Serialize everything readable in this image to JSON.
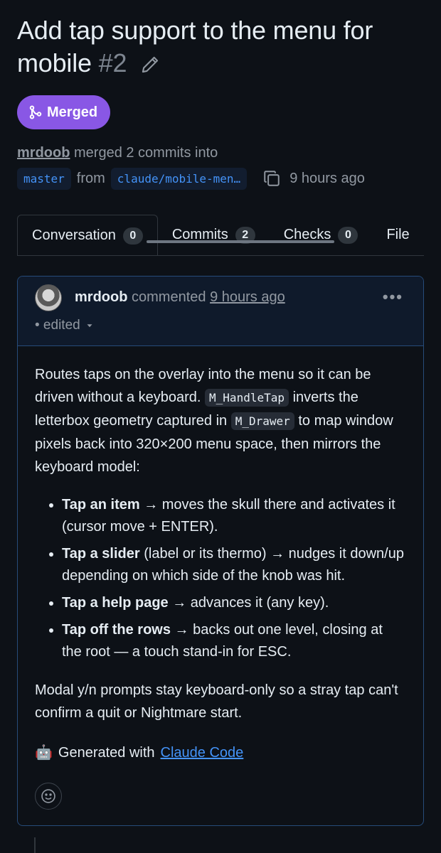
{
  "pr": {
    "title": "Add tap support to the menu for mobile",
    "number": "#2",
    "state": "Merged",
    "author": "mrdoob",
    "merge_text": "merged 2 commits into",
    "base_branch": "master",
    "from_text": "from",
    "head_branch": "claude/mobile-men…",
    "time": "9 hours ago"
  },
  "tabs": [
    {
      "label": "Conversation",
      "count": "0"
    },
    {
      "label": "Commits",
      "count": "2"
    },
    {
      "label": "Checks",
      "count": "0"
    },
    {
      "label": "File"
    }
  ],
  "comment": {
    "author": "mrdoob",
    "action": "commented",
    "time": "9 hours ago",
    "edited": "• edited",
    "intro_1": "Routes taps on the overlay into the menu so it can be driven without a keyboard.",
    "code_1": "M_HandleTap",
    "intro_2": "inverts the letterbox geometry captured in",
    "code_2": "M_Drawer",
    "intro_3": "to map window pixels back into 320×200 menu space, then mirrors the keyboard model:",
    "items": [
      {
        "bold": "Tap an item",
        "text": "→ moves the skull there and activates it (cursor move + ENTER)."
      },
      {
        "bold": "Tap a slider",
        "text": "(label or its thermo) → nudges it down/up depending on which side of the knob was hit."
      },
      {
        "bold": "Tap a help page",
        "text": "→ advances it (any key)."
      },
      {
        "bold": "Tap off the rows",
        "text": "→ backs out one level, closing at the root — a touch stand-in for ESC."
      }
    ],
    "closing": "Modal y/n prompts stay keyboard-only so a stray tap can't confirm a quit or Nightmare start.",
    "generated_emoji": "🤖",
    "generated_text": "Generated with",
    "generated_link": "Claude Code"
  },
  "icons": {
    "edit": "pencil-icon",
    "merge": "git-merge-icon",
    "copy": "copy-icon",
    "kebab": "kebab-horizontal-icon",
    "caret": "triangle-down-icon",
    "reaction": "smiley-icon"
  },
  "colors": {
    "background": "#0d1117",
    "merged": "#8957e5",
    "link": "#4493f8",
    "border_accent": "#264b7a"
  }
}
